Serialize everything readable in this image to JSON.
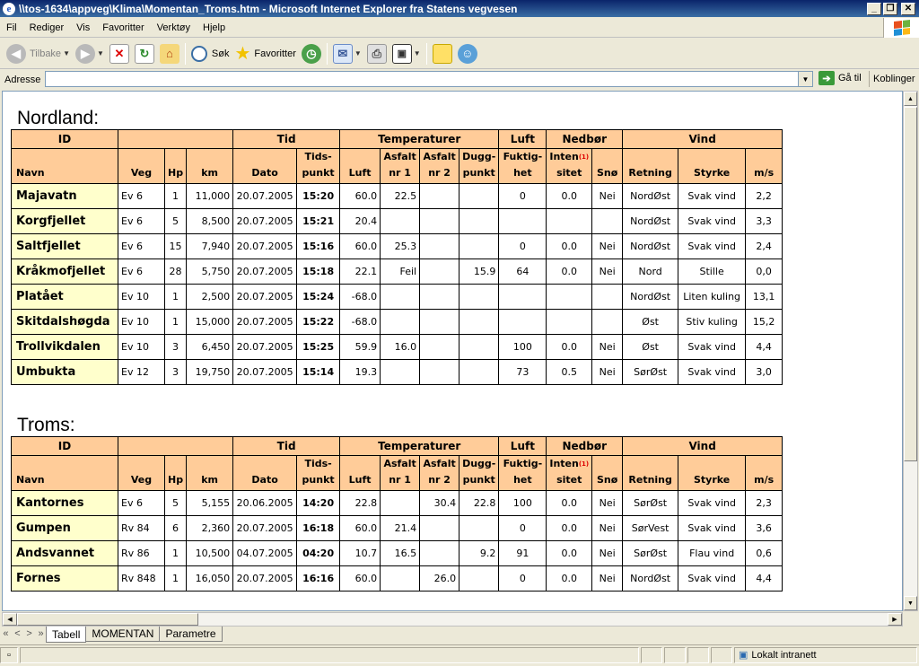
{
  "window": {
    "title": "\\\\tos-1634\\appveg\\Klima\\Momentan_Troms.htm - Microsoft Internet Explorer fra Statens vegvesen"
  },
  "menu": [
    "Fil",
    "Rediger",
    "Vis",
    "Favoritter",
    "Verktøy",
    "Hjelp"
  ],
  "toolbar": {
    "back": "Tilbake",
    "search": "Søk",
    "favorites": "Favoritter"
  },
  "address": {
    "label": "Adresse",
    "value": "",
    "go": "Gå til",
    "links": "Koblinger"
  },
  "table_headers": {
    "group_id": "ID",
    "group_tid": "Tid",
    "group_temp": "Temperaturer",
    "group_luft": "Luft",
    "group_nedbor": "Nedbør",
    "group_vind": "Vind",
    "navn": "Navn",
    "veg": "Veg",
    "hp": "Hp",
    "km": "km",
    "dato": "Dato",
    "tidspunkt_1": "Tids-",
    "tidspunkt_2": "punkt",
    "luft": "Luft",
    "asfalt1_1": "Asfalt",
    "asfalt1_2": "nr 1",
    "asfalt2_1": "Asfalt",
    "asfalt2_2": "nr 2",
    "dugg_1": "Dugg-",
    "dugg_2": "punkt",
    "fukt_1": "Fuktig-",
    "fukt_2": "het",
    "inten_1": "Inten",
    "inten_2": "sitet",
    "inten_sup": "(1)",
    "sno": "Snø",
    "retning": "Retning",
    "styrke": "Styrke",
    "ms": "m/s"
  },
  "sections": [
    {
      "title": "Nordland:",
      "rows": [
        {
          "navn": "Majavatn",
          "veg": "Ev 6",
          "hp": "1",
          "km": "11,000",
          "dato": "20.07.2005",
          "tid": "15:20",
          "luft": "60.0",
          "asfalt1": "22.5",
          "asfalt2": "",
          "dugg": "",
          "fukt": "0",
          "inten": "0.0",
          "sno": "Nei",
          "retning": "NordØst",
          "styrke": "Svak vind",
          "ms": "2,2"
        },
        {
          "navn": "Korgfjellet",
          "veg": "Ev 6",
          "hp": "5",
          "km": "8,500",
          "dato": "20.07.2005",
          "tid": "15:21",
          "luft": "20.4",
          "asfalt1": "",
          "asfalt2": "",
          "dugg": "",
          "fukt": "",
          "inten": "",
          "sno": "",
          "retning": "NordØst",
          "styrke": "Svak vind",
          "ms": "3,3"
        },
        {
          "navn": "Saltfjellet",
          "veg": "Ev 6",
          "hp": "15",
          "km": "7,940",
          "dato": "20.07.2005",
          "tid": "15:16",
          "luft": "60.0",
          "asfalt1": "25.3",
          "asfalt2": "",
          "dugg": "",
          "fukt": "0",
          "inten": "0.0",
          "sno": "Nei",
          "retning": "NordØst",
          "styrke": "Svak vind",
          "ms": "2,4"
        },
        {
          "navn": "Kråkmofjellet",
          "veg": "Ev 6",
          "hp": "28",
          "km": "5,750",
          "dato": "20.07.2005",
          "tid": "15:18",
          "luft": "22.1",
          "asfalt1": "Feil",
          "asfalt2": "",
          "dugg": "15.9",
          "fukt": "64",
          "inten": "0.0",
          "sno": "Nei",
          "retning": "Nord",
          "styrke": "Stille",
          "ms": "0,0"
        },
        {
          "navn": "Platået",
          "veg": "Ev 10",
          "hp": "1",
          "km": "2,500",
          "dato": "20.07.2005",
          "tid": "15:24",
          "luft": "-68.0",
          "asfalt1": "",
          "asfalt2": "",
          "dugg": "",
          "fukt": "",
          "inten": "",
          "sno": "",
          "retning": "NordØst",
          "styrke": "Liten kuling",
          "ms": "13,1"
        },
        {
          "navn": "Skitdalshøgda",
          "veg": "Ev 10",
          "hp": "1",
          "km": "15,000",
          "dato": "20.07.2005",
          "tid": "15:22",
          "luft": "-68.0",
          "asfalt1": "",
          "asfalt2": "",
          "dugg": "",
          "fukt": "",
          "inten": "",
          "sno": "",
          "retning": "Øst",
          "styrke": "Stiv kuling",
          "ms": "15,2"
        },
        {
          "navn": "Trollvikdalen",
          "veg": "Ev 10",
          "hp": "3",
          "km": "6,450",
          "dato": "20.07.2005",
          "tid": "15:25",
          "luft": "59.9",
          "asfalt1": "16.0",
          "asfalt2": "",
          "dugg": "",
          "fukt": "100",
          "inten": "0.0",
          "sno": "Nei",
          "retning": "Øst",
          "styrke": "Svak vind",
          "ms": "4,4"
        },
        {
          "navn": "Umbukta",
          "veg": "Ev 12",
          "hp": "3",
          "km": "19,750",
          "dato": "20.07.2005",
          "tid": "15:14",
          "luft": "19.3",
          "asfalt1": "",
          "asfalt2": "",
          "dugg": "",
          "fukt": "73",
          "inten": "0.5",
          "sno": "Nei",
          "retning": "SørØst",
          "styrke": "Svak vind",
          "ms": "3,0"
        }
      ]
    },
    {
      "title": "Troms:",
      "rows": [
        {
          "navn": "Kantornes",
          "veg": "Ev 6",
          "hp": "5",
          "km": "5,155",
          "dato": "20.06.2005",
          "tid": "14:20",
          "luft": "22.8",
          "asfalt1": "",
          "asfalt2": "30.4",
          "dugg": "22.8",
          "fukt": "100",
          "inten": "0.0",
          "sno": "Nei",
          "retning": "SørØst",
          "styrke": "Svak vind",
          "ms": "2,3"
        },
        {
          "navn": "Gumpen",
          "veg": "Rv 84",
          "hp": "6",
          "km": "2,360",
          "dato": "20.07.2005",
          "tid": "16:18",
          "luft": "60.0",
          "asfalt1": "21.4",
          "asfalt2": "",
          "dugg": "",
          "fukt": "0",
          "inten": "0.0",
          "sno": "Nei",
          "retning": "SørVest",
          "styrke": "Svak vind",
          "ms": "3,6"
        },
        {
          "navn": "Andsvannet",
          "veg": "Rv 86",
          "hp": "1",
          "km": "10,500",
          "dato": "04.07.2005",
          "tid": "04:20",
          "luft": "10.7",
          "asfalt1": "16.5",
          "asfalt2": "",
          "dugg": "9.2",
          "fukt": "91",
          "inten": "0.0",
          "sno": "Nei",
          "retning": "SørØst",
          "styrke": "Flau vind",
          "ms": "0,6"
        },
        {
          "navn": "Fornes",
          "veg": "Rv 848",
          "hp": "1",
          "km": "16,050",
          "dato": "20.07.2005",
          "tid": "16:16",
          "luft": "60.0",
          "asfalt1": "",
          "asfalt2": "26.0",
          "dugg": "",
          "fukt": "0",
          "inten": "0.0",
          "sno": "Nei",
          "retning": "NordØst",
          "styrke": "Svak vind",
          "ms": "4,4"
        }
      ]
    }
  ],
  "sheet_nav": [
    "«",
    "<",
    ">",
    "»"
  ],
  "sheet_tabs": [
    "Tabell",
    "MOMENTAN",
    "Parametre"
  ],
  "status": {
    "zone": "Lokalt intranett"
  }
}
